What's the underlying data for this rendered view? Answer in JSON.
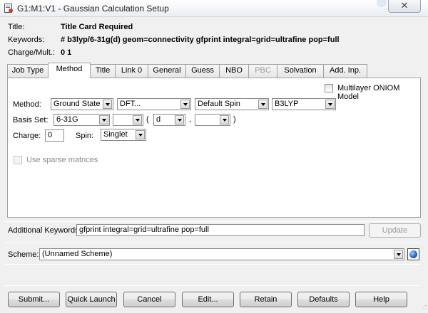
{
  "window": {
    "title": "G1:M1:V1 - Gaussian Calculation Setup",
    "close_glyph": "✕",
    "icon": "gaussian-app-icon"
  },
  "header": {
    "title_label": "Title:",
    "title_value": "Title Card Required",
    "keywords_label": "Keywords:",
    "keywords_value": "# b3lyp/6-31g(d) geom=connectivity gfprint integral=grid=ultrafine pop=full",
    "charge_label": "Charge/Mult.:",
    "charge_value": "0 1"
  },
  "tabs": [
    {
      "label": "Job Type",
      "active": false,
      "disabled": false
    },
    {
      "label": "Method",
      "active": true,
      "disabled": false
    },
    {
      "label": "Title",
      "active": false,
      "disabled": false
    },
    {
      "label": "Link 0",
      "active": false,
      "disabled": false
    },
    {
      "label": "General",
      "active": false,
      "disabled": false
    },
    {
      "label": "Guess",
      "active": false,
      "disabled": false
    },
    {
      "label": "NBO",
      "active": false,
      "disabled": false
    },
    {
      "label": "PBC",
      "active": false,
      "disabled": true
    },
    {
      "label": "Solvation",
      "active": false,
      "disabled": false
    },
    {
      "label": "Add. Inp.",
      "active": false,
      "disabled": false
    }
  ],
  "method_tab": {
    "oniom_label": "Multilayer ONIOM Model",
    "method_label": "Method:",
    "method_state": "Ground State",
    "method_theory": "DFT...",
    "method_spin": "Default Spin",
    "method_functional": "B3LYP",
    "basis_label": "Basis Set:",
    "basis_set": "6-31G",
    "basis_diffuse": "",
    "paren_open": "(",
    "basis_polar_heavy": "d",
    "comma": ",",
    "basis_polar_h": "",
    "paren_close": ")",
    "charge_label": "Charge:",
    "charge_value": "0",
    "spin_label": "Spin:",
    "spin_value": "Singlet",
    "sparse_label": "Use sparse matrices"
  },
  "additional": {
    "label": "Additional Keywords:",
    "value": "gfprint integral=grid=ultrafine pop=full",
    "update_label": "Update"
  },
  "scheme": {
    "label": "Scheme:",
    "value": "(Unnamed Scheme)"
  },
  "buttons": {
    "submit": "Submit...",
    "quick_launch": "Quick Launch",
    "cancel": "Cancel",
    "edit": "Edit...",
    "retain": "Retain",
    "defaults": "Defaults",
    "help": "Help"
  },
  "colors": {
    "dialog_bg": "#f0f0f0",
    "panel_bg": "#ffffff",
    "border": "#a0a0a0"
  }
}
